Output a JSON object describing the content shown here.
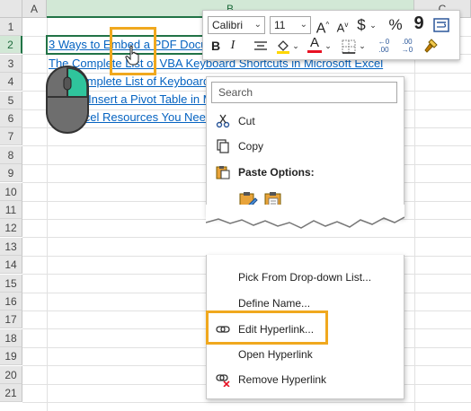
{
  "sheet": {
    "columns": [
      "A",
      "B",
      "C"
    ],
    "rows": [
      "1",
      "2",
      "3",
      "4",
      "5",
      "6",
      "7",
      "8",
      "9",
      "10",
      "11",
      "12",
      "13",
      "14",
      "15",
      "16",
      "17",
      "18",
      "19",
      "20",
      "21"
    ],
    "links": [
      "3 Ways to Embed a PDF Document in Microsoft Excel",
      "The Complete List of VBA Keyboard Shortcuts in Microsoft Excel",
      "The Complete List of Keyboard Shortcuts in Microsoft Excel",
      "How to Insert a Pivot Table in Microsoft Excel",
      "Top Excel Resources You Need to Know"
    ]
  },
  "mini_toolbar": {
    "font_name": "Calibri",
    "font_size": "11",
    "grow_font": "A",
    "shrink_font": "A",
    "currency": "$",
    "percent": "%",
    "comma": "9",
    "bold": "B",
    "italic": "I",
    "font_color_letter": "A",
    "colors": {
      "fill": "#ffd700",
      "font": "#e81123"
    }
  },
  "context_menu": {
    "search_placeholder": "Search",
    "items_top": [
      {
        "label": "Cut",
        "icon": "scissors-icon"
      },
      {
        "label": "Copy",
        "icon": "copy-icon"
      },
      {
        "label": "Paste Options:",
        "icon": "paste-icon"
      }
    ],
    "items_bottom": [
      {
        "label": "Pick From Drop-down List...",
        "icon": ""
      },
      {
        "label": "Define Name...",
        "icon": ""
      },
      {
        "label": "Edit Hyperlink...",
        "icon": "link-icon"
      },
      {
        "label": "Open Hyperlink",
        "icon": ""
      },
      {
        "label": "Remove Hyperlink",
        "icon": "remove-link-icon"
      }
    ]
  },
  "colors": {
    "highlight": "#f0a81e",
    "accent": "#217346",
    "link": "#0563c1"
  }
}
